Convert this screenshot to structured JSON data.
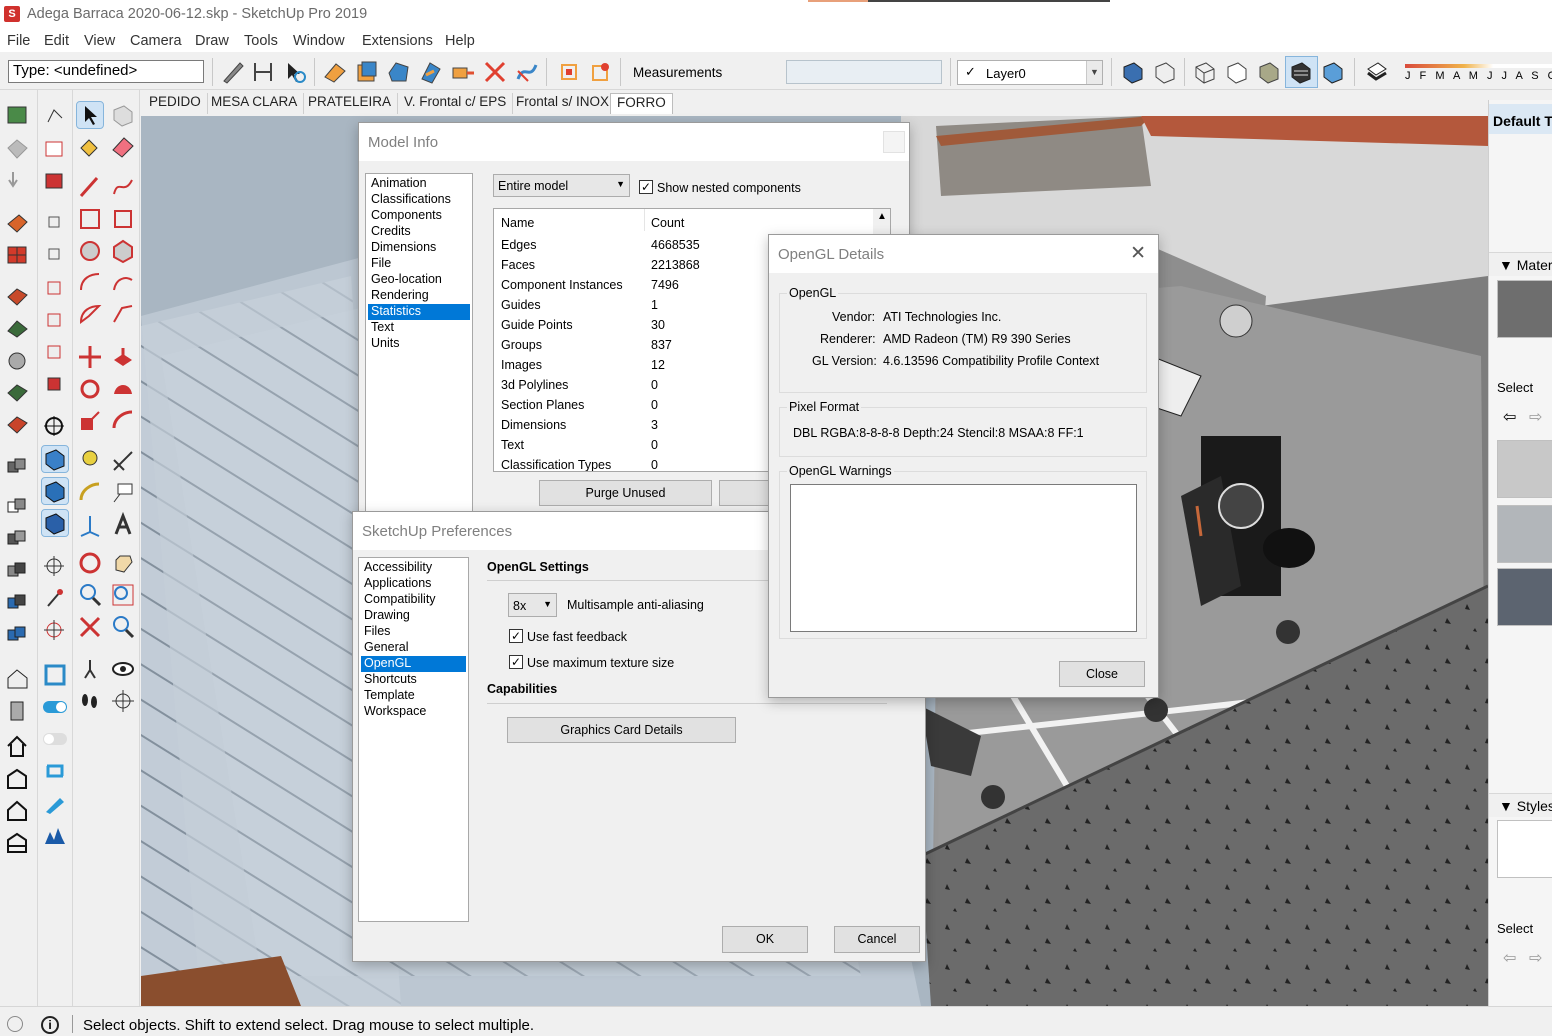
{
  "window": {
    "title": "Adega Barraca 2020-06-12.skp - SketchUp Pro 2019",
    "logo": "S"
  },
  "menu": [
    "File",
    "Edit",
    "View",
    "Camera",
    "Draw",
    "Tools",
    "Window",
    "Extensions",
    "Help"
  ],
  "toolbar": {
    "type_field": "Type: <undefined>",
    "measurements_label": "Measurements",
    "measurements_value": "",
    "layer": "Layer0",
    "months": "J F M A M J J A S O"
  },
  "scene_tabs": [
    "PEDIDO",
    "MESA CLARA",
    "PRATELEIRA",
    "V. Frontal c/ EPS",
    "Frontal s/ INOX",
    "FORRO"
  ],
  "active_scene": "FORRO",
  "model_info": {
    "title": "Model Info",
    "nav": [
      "Animation",
      "Classifications",
      "Components",
      "Credits",
      "Dimensions",
      "File",
      "Geo-location",
      "Rendering",
      "Statistics",
      "Text",
      "Units"
    ],
    "selected_nav": "Statistics",
    "scope": "Entire model",
    "show_nested_label": "Show nested components",
    "show_nested_checked": "✓",
    "col_name": "Name",
    "col_count": "Count",
    "rows": [
      {
        "name": "Edges",
        "count": "4668535"
      },
      {
        "name": "Faces",
        "count": "2213868"
      },
      {
        "name": "Component Instances",
        "count": "7496"
      },
      {
        "name": "Guides",
        "count": "1"
      },
      {
        "name": "Guide Points",
        "count": "30"
      },
      {
        "name": "Groups",
        "count": "837"
      },
      {
        "name": "Images",
        "count": "12"
      },
      {
        "name": "3d Polylines",
        "count": "0"
      },
      {
        "name": "Section Planes",
        "count": "0"
      },
      {
        "name": "Dimensions",
        "count": "3"
      },
      {
        "name": "Text",
        "count": "0"
      },
      {
        "name": "Classification Types",
        "count": "0"
      }
    ],
    "purge_label": "Purge Unused"
  },
  "preferences": {
    "title": "SketchUp Preferences",
    "nav": [
      "Accessibility",
      "Applications",
      "Compatibility",
      "Drawing",
      "Files",
      "General",
      "OpenGL",
      "Shortcuts",
      "Template",
      "Workspace"
    ],
    "selected_nav": "OpenGL",
    "opengl_heading": "OpenGL Settings",
    "msaa_value": "8x",
    "msaa_label": "Multisample anti-aliasing",
    "fast_feedback_label": "Use fast feedback",
    "max_texture_label": "Use maximum texture size",
    "checked_mark": "✓",
    "capabilities_heading": "Capabilities",
    "graphics_btn": "Graphics Card Details",
    "ok": "OK",
    "cancel": "Cancel"
  },
  "opengl_details": {
    "title": "OpenGL Details",
    "group_opengl": "OpenGL",
    "vendor_label": "Vendor:",
    "vendor": "ATI Technologies Inc.",
    "renderer_label": "Renderer:",
    "renderer": "AMD Radeon (TM) R9 390 Series",
    "glversion_label": "GL Version:",
    "glversion": "4.6.13596 Compatibility Profile Context",
    "group_pixel": "Pixel Format",
    "pixel_format": "DBL RGBA:8-8-8-8 Depth:24 Stencil:8 MSAA:8 FF:1",
    "group_warnings": "OpenGL Warnings",
    "warnings": "",
    "close": "Close"
  },
  "tray": {
    "default_tray": "Default Tray",
    "materials": "Materials",
    "styles": "Styles",
    "select": "Select",
    "select2": "Select"
  },
  "status": {
    "text": "Select objects. Shift to extend select. Drag mouse to select multiple."
  },
  "colors": {
    "accent": "#0078d7",
    "selected_tool_bg": "#cfe3f5"
  }
}
